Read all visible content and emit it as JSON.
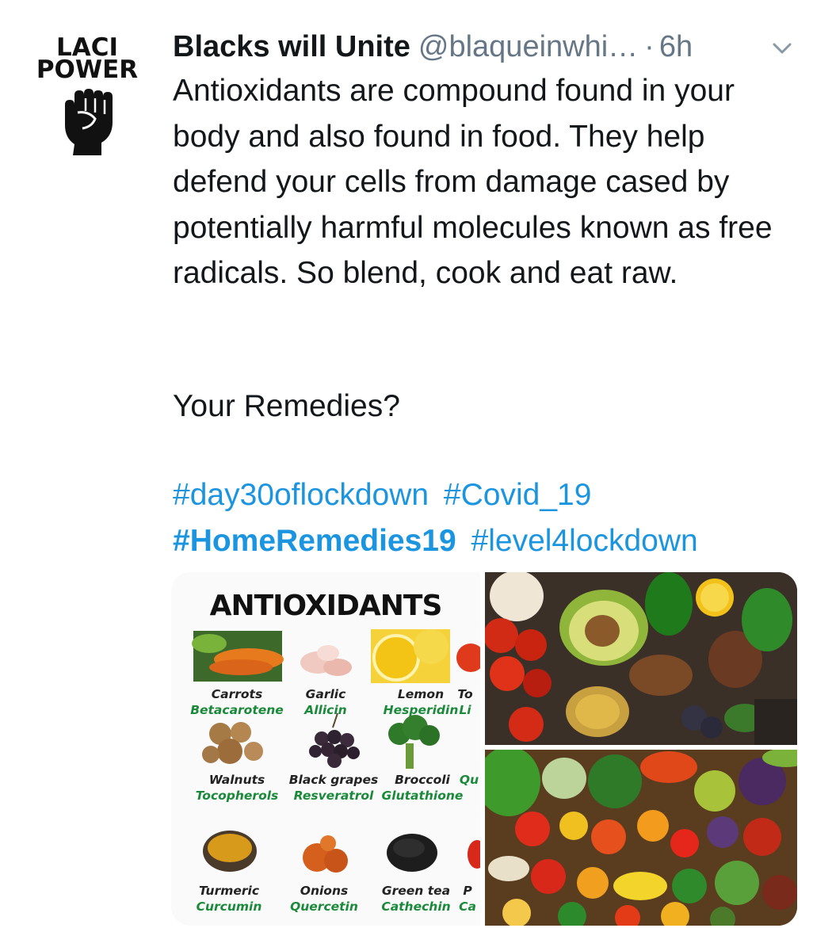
{
  "tweet": {
    "avatar": {
      "line1": "LACI",
      "line2": "POWER",
      "icon": "raised-fist-icon"
    },
    "author_name": "Blacks will Unite",
    "author_handle": "@blaqueinwhi…",
    "separator": "·",
    "time": "6h",
    "menu_icon": "chevron-down-icon",
    "body": "Antioxidants are compound found in your body and also found in food. They help defend your cells from damage cased by potentially harmful molecules known as free radicals. So blend, cook and eat raw.",
    "question": "Your Remedies?",
    "hashtags": [
      {
        "text": "#day30oflockdown"
      },
      {
        "text": "#Covid_19"
      },
      {
        "text": "#HomeRemedies19"
      },
      {
        "text": "#level4lockdown"
      }
    ]
  },
  "media": {
    "infographic": {
      "title": "ANTIOXIDANTS",
      "items": [
        {
          "name": "Carrots",
          "compound": "Betacarotene"
        },
        {
          "name": "Garlic",
          "compound": "Allicin"
        },
        {
          "name": "Lemon",
          "compound": "Hesperidin"
        },
        {
          "name": "To",
          "compound": "Li"
        },
        {
          "name": "Walnuts",
          "compound": "Tocopherols"
        },
        {
          "name": "Black grapes",
          "compound": "Resveratrol"
        },
        {
          "name": "Broccoli",
          "compound": "Glutathione"
        },
        {
          "name": "",
          "compound": "Qu"
        },
        {
          "name": "Turmeric",
          "compound": "Curcumin"
        },
        {
          "name": "Onions",
          "compound": "Quercetin"
        },
        {
          "name": "Green tea",
          "compound": "Cathechin"
        },
        {
          "name": "P",
          "compound": "Ca"
        }
      ]
    },
    "photo_top": "avocado-vegetables-photo",
    "photo_bottom": "mixed-fruits-vegetables-photo"
  },
  "colors": {
    "link": "#1b95e0",
    "text": "#14171a",
    "secondary": "#657786",
    "compound_green": "#1a8a3a"
  }
}
